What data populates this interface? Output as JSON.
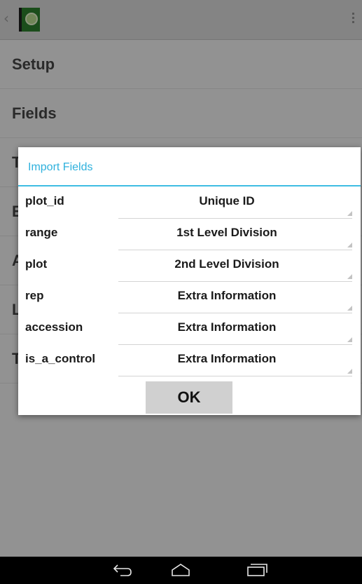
{
  "settings": {
    "items": [
      "Setup",
      "Fields",
      "T",
      "E",
      "A",
      "L",
      "T"
    ]
  },
  "dialog": {
    "title": "Import Fields",
    "rows": [
      {
        "field": "plot_id",
        "type": "Unique ID"
      },
      {
        "field": "range",
        "type": "1st Level Division"
      },
      {
        "field": "plot",
        "type": "2nd Level Division"
      },
      {
        "field": "rep",
        "type": "Extra Information"
      },
      {
        "field": "accession",
        "type": "Extra Information"
      },
      {
        "field": "is_a_control",
        "type": "Extra Information"
      }
    ],
    "ok_label": "OK"
  },
  "icons": {
    "app": "app-icon",
    "overflow": "overflow-menu-icon",
    "back": "back-icon",
    "home": "home-icon",
    "recent": "recent-apps-icon"
  },
  "colors": {
    "accent": "#33b5e5"
  }
}
